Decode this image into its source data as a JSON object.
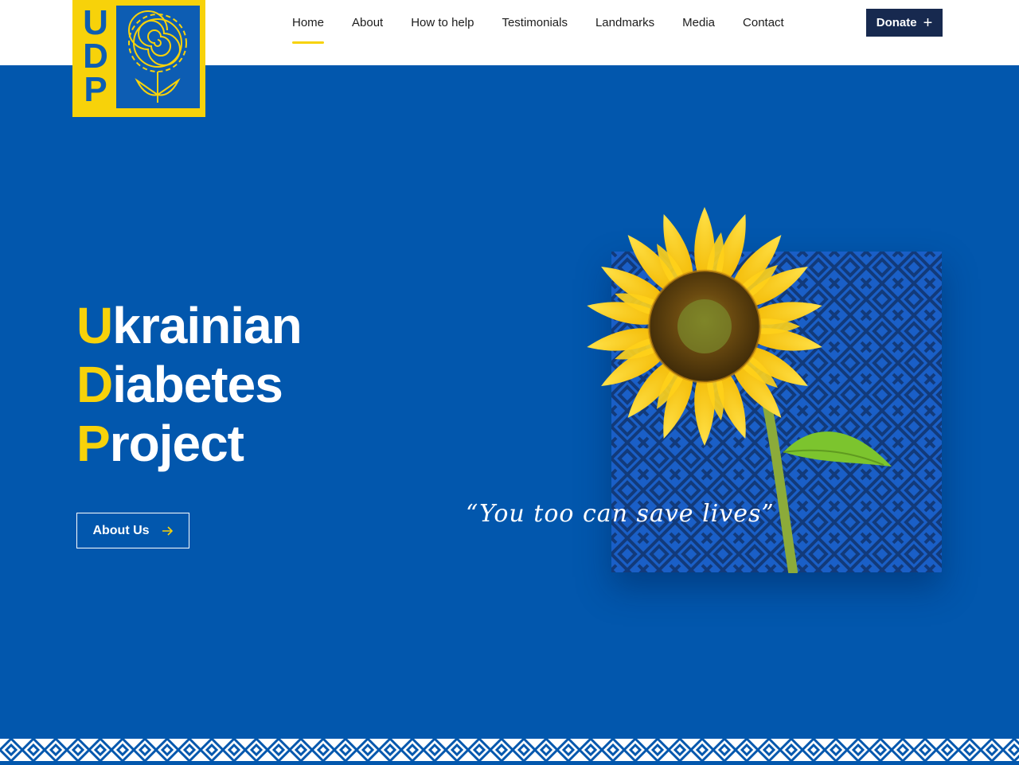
{
  "logo": {
    "letters": [
      "U",
      "D",
      "P"
    ],
    "icon": "sunflower-logo-icon"
  },
  "nav": {
    "items": [
      "Home",
      "About",
      "How to help",
      "Testimonials",
      "Landmarks",
      "Media",
      "Contact"
    ],
    "active": "Home"
  },
  "donate": {
    "label": "Donate",
    "icon": "plus-icon"
  },
  "hero": {
    "title_lines": [
      {
        "first": "U",
        "rest": "krainian"
      },
      {
        "first": "D",
        "rest": "iabetes"
      },
      {
        "first": "P",
        "rest": "roject"
      }
    ],
    "about_button": "About Us",
    "about_icon": "arrow-right-icon",
    "quote": "“You too can save lives”"
  },
  "colors": {
    "brand_blue": "#0257ad",
    "brand_yellow": "#f7d20a",
    "navy": "#17294f",
    "header_bg": "#ffffff"
  }
}
